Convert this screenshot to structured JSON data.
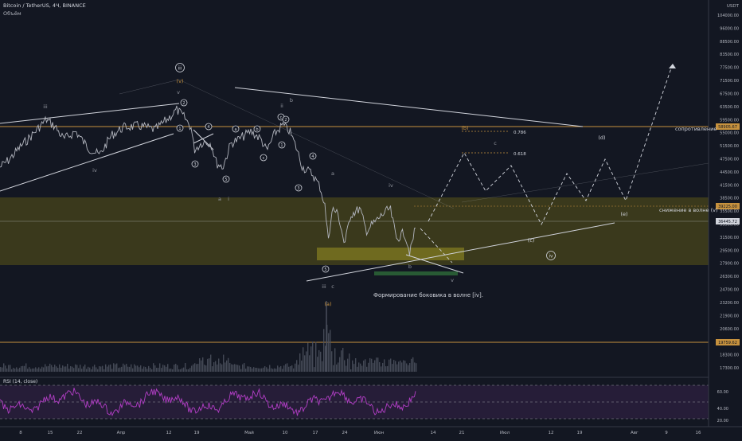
{
  "header": {
    "symbol": "Bitcoin / TetherUS, 4Ч, BINANCE",
    "volume": "Объём",
    "rsi": "RSI (14, close)"
  },
  "price_axis": {
    "unit": "USDT",
    "ticks": [
      "104000.00",
      "96000.00",
      "88500.00",
      "83500.00",
      "77500.00",
      "71500.00",
      "67500.00",
      "63500.00",
      "59500.00",
      "55000.00",
      "51500.00",
      "47500.00",
      "44500.00",
      "41500.00",
      "38500.00",
      "35500.00",
      "33500.00",
      "31500.00",
      "29500.00",
      "27900.00",
      "26300.00",
      "24700.00",
      "23200.00",
      "21900.00",
      "20600.00",
      "19700.00",
      "18300.00",
      "17300.00"
    ],
    "flags": [
      {
        "text": "58905.67",
        "color": "#c7923e"
      },
      {
        "text": "39225.00",
        "color": "#c7923e"
      },
      {
        "text": "36445.72",
        "color": "#d1d4dc"
      },
      {
        "text": "19759.62",
        "color": "#c7923e"
      }
    ]
  },
  "rsi_axis": {
    "ticks": [
      "60.00",
      "40.00",
      "20.00"
    ]
  },
  "time_axis": {
    "ticks": [
      "8",
      "15",
      "22",
      "Апр",
      "12",
      "19",
      "Май",
      "10",
      "17",
      "24",
      "Июн",
      "14",
      "21",
      "Июл",
      "12",
      "19",
      "Авг",
      "9",
      "16"
    ]
  },
  "zones": {
    "resistance": "сопротивление",
    "decline": "снижение в волне (v)"
  },
  "waves": {
    "iii_circ": "iii",
    "v_par": "(v)",
    "v_small": "v",
    "n1": "1",
    "n2": "2",
    "n3": "3",
    "n4": "4",
    "n5": "5",
    "roman_iii": "iii",
    "roman_iv": "iv",
    "roman_ii": "ii",
    "a_big": "a",
    "b_big": "b",
    "i_small": "i",
    "a_small": "a",
    "iv_small": "iv",
    "c_small": "c",
    "b_small": "b",
    "v_bottom": "v",
    "a_par": "(a)",
    "b_par": "(b)",
    "c_par": "(c)",
    "d_par": "(d)",
    "e_par": "(e)",
    "iv_circ": "iv",
    "c_fib": "c",
    "fib_786": "0.786",
    "fib_618": "0.618"
  },
  "annotation": "Формирование боковика в волне [iv].",
  "colors": {
    "bg": "#131722",
    "price": "#b2b5be",
    "orange": "#c7923e",
    "zone": "#6b6416",
    "rsi": "#9c27b0"
  }
}
